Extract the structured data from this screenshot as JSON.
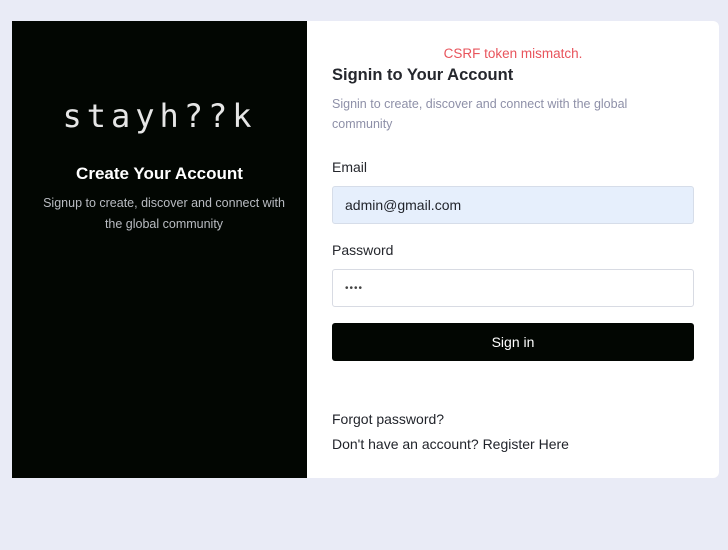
{
  "left": {
    "logo_text": "stayh??k",
    "title": "Create Your Account",
    "subtitle": "Signup to create, discover and connect with the global community"
  },
  "right": {
    "error": "CSRF token mismatch.",
    "title": "Signin to Your Account",
    "subtitle": "Signin to create, discover and connect with the global community",
    "email_label": "Email",
    "email_value": "admin@gmail.com",
    "password_label": "Password",
    "password_value": "••••",
    "signin_label": "Sign in",
    "forgot_label": "Forgot password?",
    "register_prompt": "Don't have an account?",
    "register_link": "Register Here"
  },
  "colors": {
    "background": "#e9ebf6",
    "panel_dark": "#020602",
    "error": "#e8545c",
    "input_filled": "#e6effc"
  }
}
